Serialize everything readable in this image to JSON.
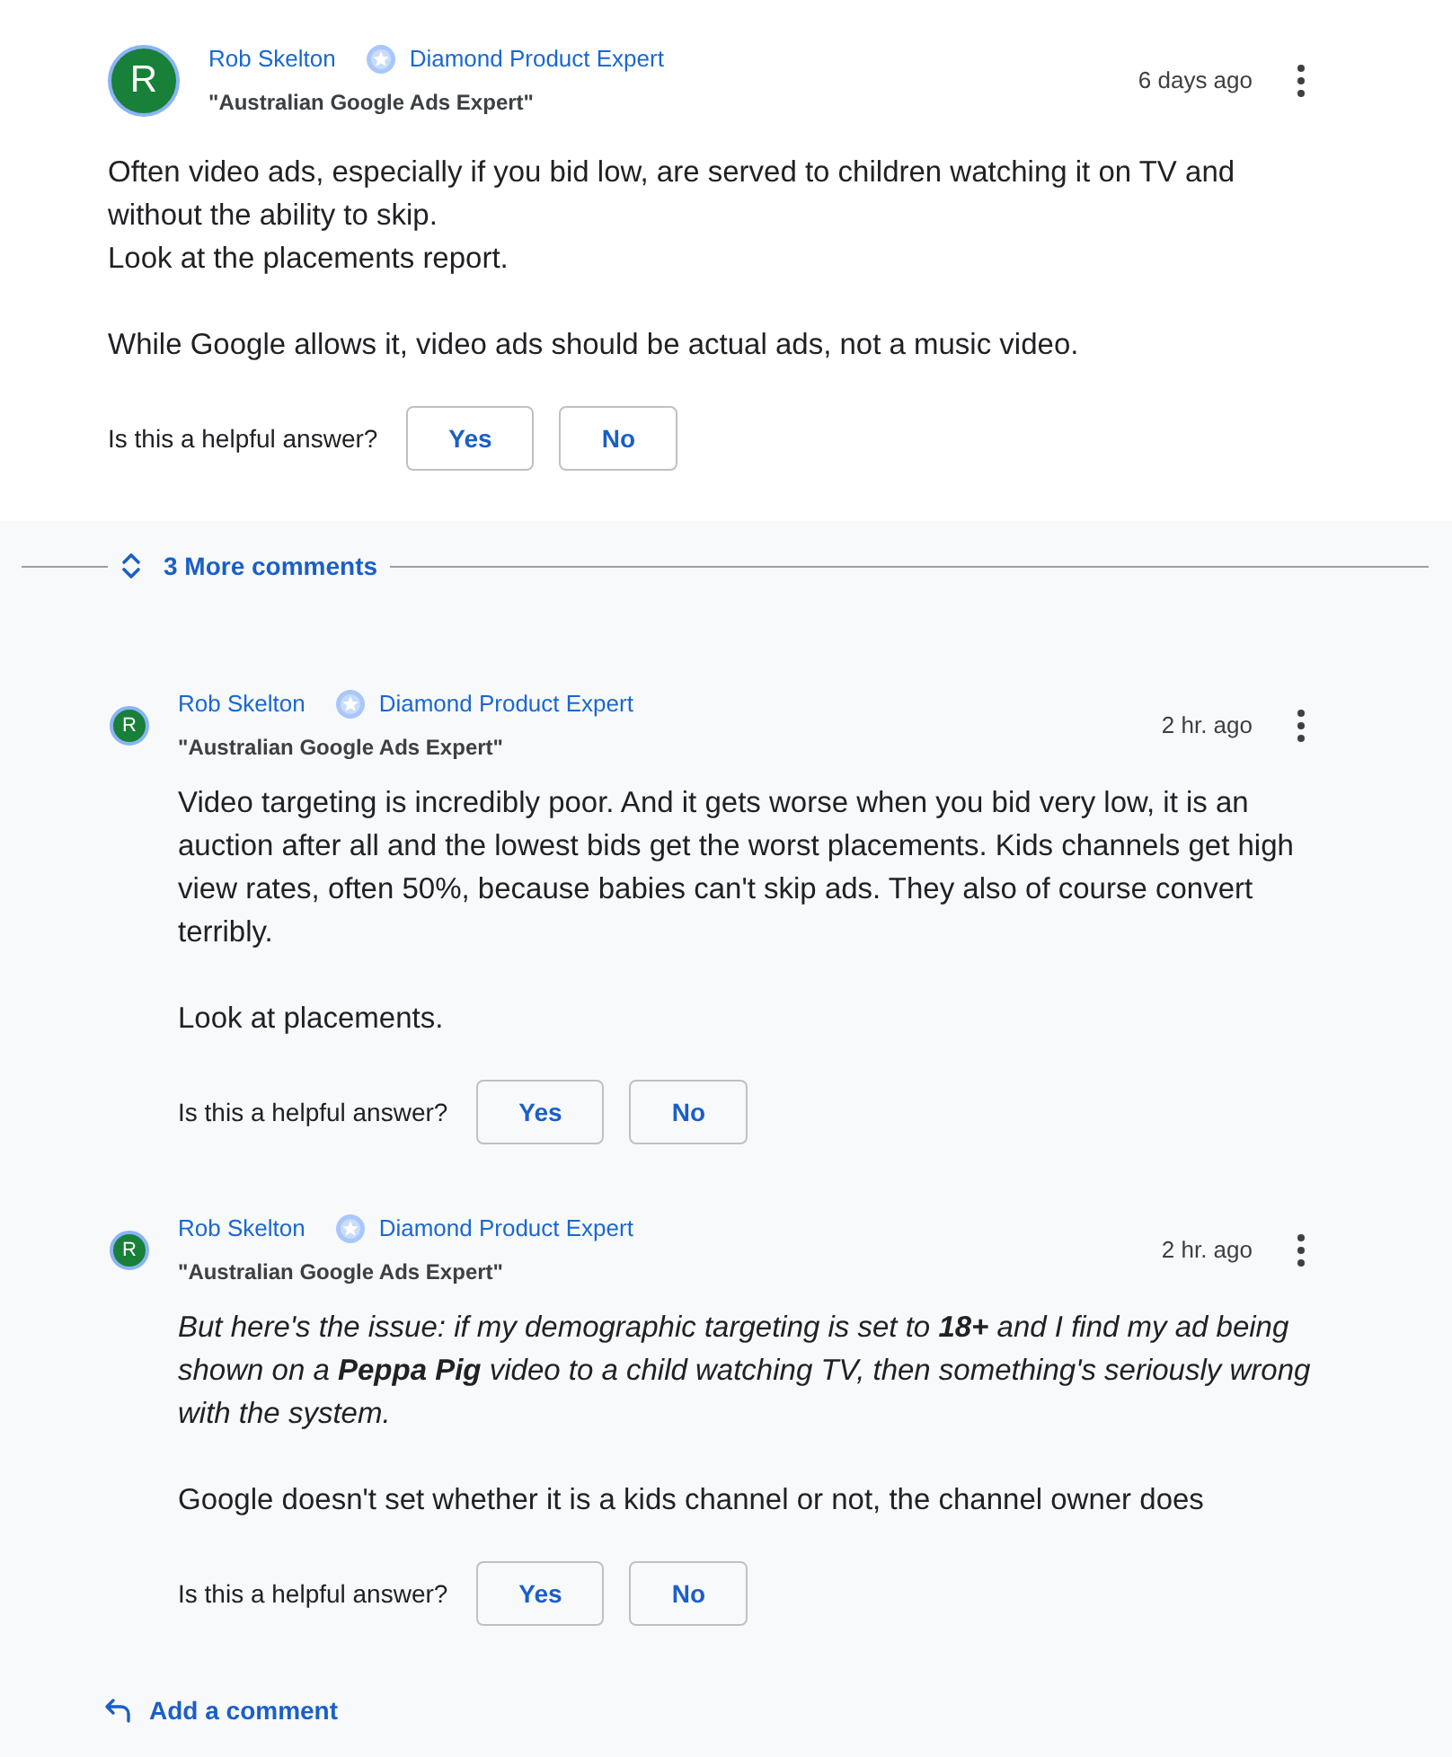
{
  "answer": {
    "author": {
      "name": "Rob Skelton",
      "avatar_letter": "R",
      "badge": "Diamond Product Expert",
      "title": "\"Australian Google Ads Expert\"",
      "time": "6 days ago"
    },
    "paragraphs": [
      {
        "text": "Often video ads, especially if you bid low, are served to children watching it on TV and without the ability to skip.\nLook at the placements report.",
        "italic": false
      },
      {
        "text": "While Google allows it, video ads should be actual ads, not a music video.",
        "italic": false
      }
    ],
    "helpful": {
      "question": "Is this a helpful answer?",
      "buttons": [
        "Yes",
        "No"
      ]
    }
  },
  "more_comments": {
    "label": "3 More comments"
  },
  "comments": [
    {
      "author": {
        "name": "Rob Skelton",
        "avatar_letter": "R",
        "badge": "Diamond Product Expert",
        "title": "\"Australian Google Ads Expert\"",
        "time": "2 hr. ago"
      },
      "paragraphs": [
        {
          "text": "Video targeting is incredibly poor. And it gets worse when you bid very low, it is an auction after all and the lowest bids get the worst placements. Kids channels get high view rates, often 50%, because babies can't skip ads. They also of course convert terribly.",
          "italic": false
        },
        {
          "text": "Look at placements.",
          "italic": false
        }
      ],
      "helpful": {
        "question": "Is this a helpful answer?",
        "buttons": [
          "Yes",
          "No"
        ]
      }
    },
    {
      "author": {
        "name": "Rob Skelton",
        "avatar_letter": "R",
        "badge": "Diamond Product Expert",
        "title": "\"Australian Google Ads Expert\"",
        "time": "2 hr. ago"
      },
      "paragraphs": [
        {
          "text": "But here's the issue: if my demographic targeting is set to **18+** and I find my ad being shown on a **Peppa Pig** video to a child watching TV, then something's seriously wrong with the system.",
          "italic": true
        },
        {
          "text": "Google doesn't set whether it is a kids channel or not, the channel owner does",
          "italic": false
        }
      ],
      "helpful": {
        "question": "Is this a helpful answer?",
        "buttons": [
          "Yes",
          "No"
        ]
      }
    }
  ],
  "add_comment": {
    "label": "Add a comment"
  }
}
